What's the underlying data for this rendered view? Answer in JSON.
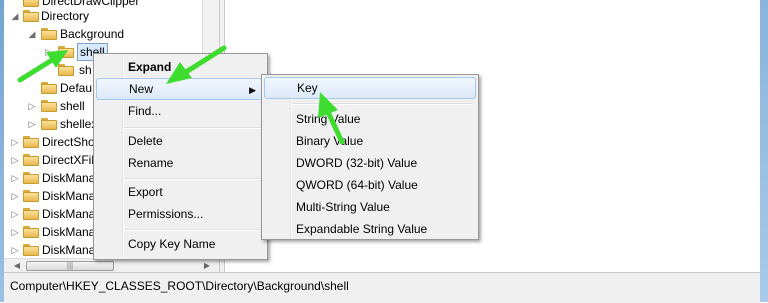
{
  "tree": {
    "rows": [
      {
        "label": "DirectDrawClipper",
        "indent": 1,
        "expander": "",
        "selected": false
      },
      {
        "label": "Directory",
        "indent": 1,
        "expander": "◢",
        "selected": false
      },
      {
        "label": "Background",
        "indent": 2,
        "expander": "◢",
        "selected": false
      },
      {
        "label": "shell",
        "indent": 3,
        "expander": "▷",
        "selected": true
      },
      {
        "label": "sh",
        "indent": 3,
        "expander": "",
        "selected": false
      },
      {
        "label": "Defau",
        "indent": 2,
        "expander": "",
        "selected": false
      },
      {
        "label": "shell",
        "indent": 2,
        "expander": "▷",
        "selected": false
      },
      {
        "label": "shellex",
        "indent": 2,
        "expander": "▷",
        "selected": false
      },
      {
        "label": "DirectSho",
        "indent": 1,
        "expander": "▷",
        "selected": false
      },
      {
        "label": "DirectXFil",
        "indent": 1,
        "expander": "▷",
        "selected": false
      },
      {
        "label": "DiskMana",
        "indent": 1,
        "expander": "▷",
        "selected": false
      },
      {
        "label": "DiskMana",
        "indent": 1,
        "expander": "▷",
        "selected": false
      },
      {
        "label": "DiskMana",
        "indent": 1,
        "expander": "▷",
        "selected": false
      },
      {
        "label": "DiskMana",
        "indent": 1,
        "expander": "▷",
        "selected": false
      },
      {
        "label": "DiskMana",
        "indent": 1,
        "expander": "▷",
        "selected": false
      }
    ],
    "hscroll_left": "◀",
    "hscroll_right": "▶",
    "hscroll_grip": "|||"
  },
  "context_menu": {
    "items": [
      {
        "label": "Expand",
        "bold": true,
        "highlighted": false,
        "submenu": false
      },
      {
        "label": "New",
        "bold": false,
        "highlighted": true,
        "submenu": true
      },
      {
        "label": "Find...",
        "bold": false,
        "highlighted": false,
        "submenu": false
      },
      {
        "label": "Delete",
        "bold": false,
        "highlighted": false,
        "submenu": false
      },
      {
        "label": "Rename",
        "bold": false,
        "highlighted": false,
        "submenu": false
      },
      {
        "label": "Export",
        "bold": false,
        "highlighted": false,
        "submenu": false
      },
      {
        "label": "Permissions...",
        "bold": false,
        "highlighted": false,
        "submenu": false
      },
      {
        "label": "Copy Key Name",
        "bold": false,
        "highlighted": false,
        "submenu": false
      }
    ],
    "submenu_arrow": "▶"
  },
  "new_submenu": {
    "items": [
      {
        "label": "Key",
        "highlighted": true
      },
      {
        "label": "String Value",
        "highlighted": false
      },
      {
        "label": "Binary Value",
        "highlighted": false
      },
      {
        "label": "DWORD (32-bit) Value",
        "highlighted": false
      },
      {
        "label": "QWORD (64-bit) Value",
        "highlighted": false
      },
      {
        "label": "Multi-String Value",
        "highlighted": false
      },
      {
        "label": "Expandable String Value",
        "highlighted": false
      }
    ]
  },
  "status_bar": {
    "path": "Computer\\HKEY_CLASSES_ROOT\\Directory\\Background\\shell"
  },
  "colors": {
    "menu_bg": "#f0f0f0",
    "highlight": "#dce9f9",
    "annotation_arrow": "#3ddc2f"
  },
  "icons": {
    "folder": "folder-icon",
    "expander": "expander-icon",
    "submenu": "chevron-right-icon"
  }
}
